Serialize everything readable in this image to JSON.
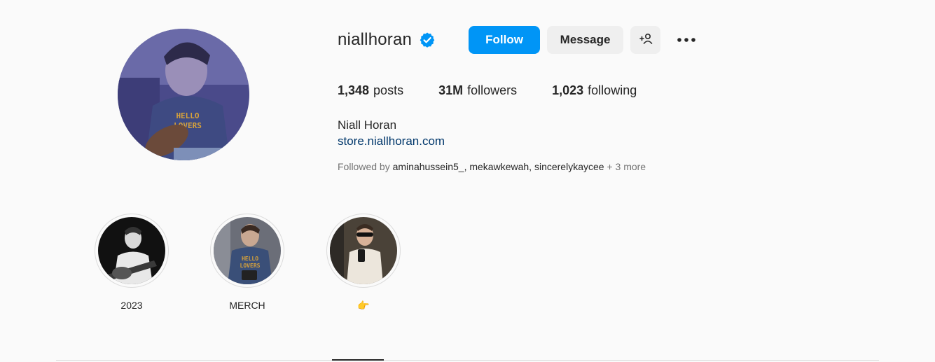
{
  "profile": {
    "username": "niallhoran",
    "full_name": "Niall Horan",
    "website": "store.niallhoran.com"
  },
  "actions": {
    "follow_label": "Follow",
    "message_label": "Message"
  },
  "stats": {
    "posts_count": "1,348",
    "posts_label": "posts",
    "followers_count": "31M",
    "followers_label": "followers",
    "following_count": "1,023",
    "following_label": "following"
  },
  "followed_by": {
    "prefix": "Followed by",
    "names": [
      "aminahussein5_",
      "mekawkewah",
      "sincerelykaycee"
    ],
    "more": "+ 3 more"
  },
  "highlights": [
    {
      "label": "2023"
    },
    {
      "label": "MERCH"
    },
    {
      "label": "👉"
    }
  ],
  "icons": {
    "verified": "verified-badge-icon",
    "add_user": "add-user-icon",
    "more": "more-options-icon"
  },
  "colors": {
    "accent": "#0095f6",
    "link": "#00376b",
    "verified": "#0095f6"
  }
}
